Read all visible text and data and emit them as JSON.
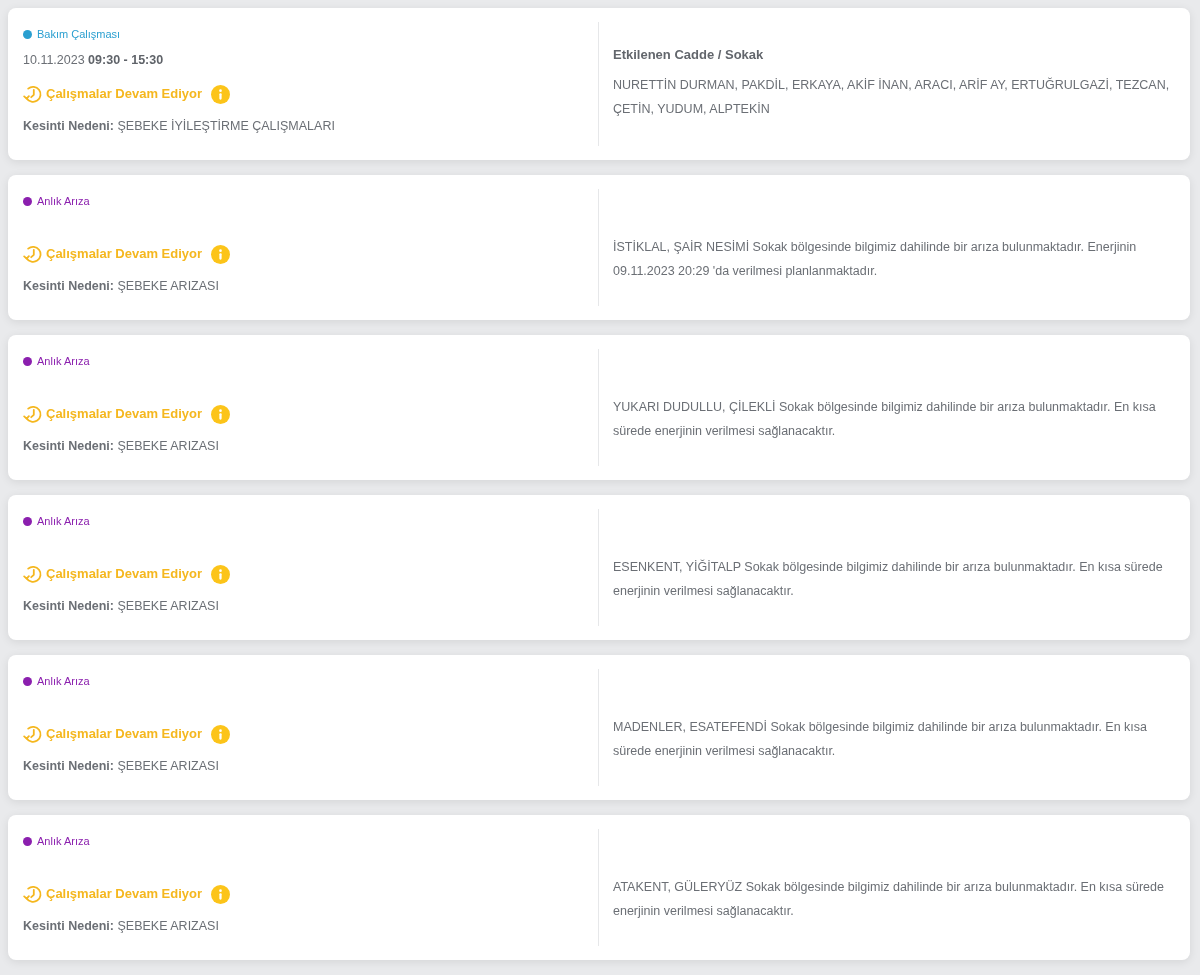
{
  "outages": [
    {
      "category": {
        "label": "Bakım Çalışması",
        "color": "#2a9fd0"
      },
      "schedule": "10.11.2023 **09:30 - 15:30**",
      "status": "Çalışmalar Devam Ediyor",
      "reason": "**Kesinti Nedeni:** ŞEBEKE İYİLEŞTİRME ÇALIŞMALARI",
      "affected": {
        "heading": "Etkilenen Cadde / Sokak",
        "text": "NURETTİN DURMAN, PAKDİL, ERKAYA, AKİF İNAN, ARACI, ARİF AY, ERTUĞRULGAZİ, TEZCAN, ÇETİN, YUDUM, ALPTEKİN"
      }
    },
    {
      "category": {
        "label": "Anlık Arıza",
        "color": "#8b1fae"
      },
      "status": "Çalışmalar Devam Ediyor",
      "reason": "**Kesinti Nedeni:** ŞEBEKE ARIZASI",
      "affected": {
        "text": "İSTİKLAL, ŞAİR NESİMİ Sokak bölgesinde bilgimiz dahilinde bir arıza bulunmaktadır. Enerjinin 09.11.2023 20:29 'da verilmesi planlanmaktadır."
      }
    },
    {
      "category": {
        "label": "Anlık Arıza",
        "color": "#8b1fae"
      },
      "status": "Çalışmalar Devam Ediyor",
      "reason": "**Kesinti Nedeni:** ŞEBEKE ARIZASI",
      "affected": {
        "text": "YUKARI DUDULLU, ÇİLEKLİ Sokak bölgesinde bilgimiz dahilinde bir arıza bulunmaktadır. En kısa sürede enerjinin verilmesi sağlanacaktır."
      }
    },
    {
      "category": {
        "label": "Anlık Arıza",
        "color": "#8b1fae"
      },
      "status": "Çalışmalar Devam Ediyor",
      "reason": "**Kesinti Nedeni:** ŞEBEKE ARIZASI",
      "affected": {
        "text": "ESENKENT, YİĞİTALP Sokak bölgesinde bilgimiz dahilinde bir arıza bulunmaktadır. En kısa sürede enerjinin verilmesi sağlanacaktır."
      }
    },
    {
      "category": {
        "label": "Anlık Arıza",
        "color": "#8b1fae"
      },
      "status": "Çalışmalar Devam Ediyor",
      "reason": "**Kesinti Nedeni:** ŞEBEKE ARIZASI",
      "affected": {
        "text": "MADENLER, ESATEFENDİ Sokak bölgesinde bilgimiz dahilinde bir arıza bulunmaktadır. En kısa sürede enerjinin verilmesi sağlanacaktır."
      }
    },
    {
      "category": {
        "label": "Anlık Arıza",
        "color": "#8b1fae"
      },
      "status": "Çalışmalar Devam Ediyor",
      "reason": "**Kesinti Nedeni:** ŞEBEKE ARIZASI",
      "affected": {
        "text": "ATAKENT, GÜLERYÜZ Sokak bölgesinde bilgimiz dahilinde bir arıza bulunmaktadır. En kısa sürede enerjinin verilmesi sağlanacaktır."
      }
    }
  ]
}
